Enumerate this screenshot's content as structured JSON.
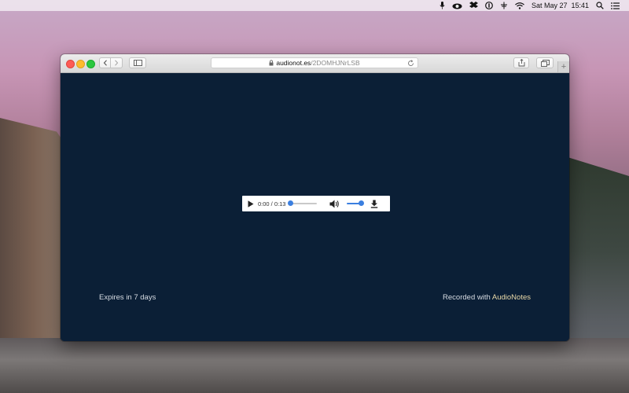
{
  "menubar": {
    "datetime": "Sat May 27  15:41",
    "icons": [
      "microphone-icon",
      "cloud-app-icon",
      "dropbox-icon",
      "1password-icon",
      "network-icon",
      "wifi-icon",
      "search-icon",
      "notification-center-icon"
    ]
  },
  "browser": {
    "address": {
      "domain": "audionot.es",
      "path": "/2DOMHJNrLSB"
    },
    "new_tab_label": "+"
  },
  "player": {
    "time_display": "0:00 / 0:13",
    "progress_fraction": 0.0,
    "volume_fraction": 1.0
  },
  "footer": {
    "expires_text": "Expires in 7 days",
    "recorded_prefix": "Recorded with ",
    "recorded_link": "AudioNotes"
  },
  "colors": {
    "page_background": "#0b1f36",
    "accent_blue": "#3b7fe0",
    "link_color": "#ead9a8"
  }
}
